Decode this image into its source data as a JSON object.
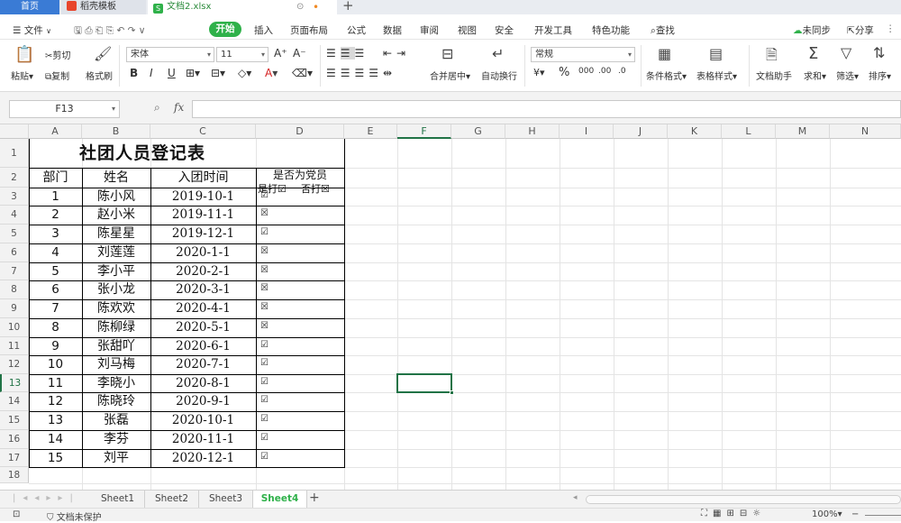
{
  "tabs": {
    "home": "首页",
    "template": "稻壳模板",
    "document": "文档2.xlsx",
    "add": "+"
  },
  "menu": {
    "file": "文件",
    "start": "开始",
    "items": [
      "插入",
      "页面布局",
      "公式",
      "数据",
      "审阅",
      "视图",
      "安全",
      "开发工具",
      "特色功能"
    ],
    "search": "查找",
    "sync": "未同步",
    "share": "分享"
  },
  "ribbon": {
    "paste": "粘贴",
    "cut": "剪切",
    "copy": "复制",
    "format_painter": "格式刷",
    "font_name": "宋体",
    "font_size": "11",
    "bold": "B",
    "italic": "I",
    "underline": "U",
    "merge_center": "合并居中",
    "wrap": "自动换行",
    "number_format": "常规",
    "percent": "%",
    "conditional_format": "条件格式",
    "table_style": "表格样式",
    "doc_assistant": "文档助手",
    "sum": "求和",
    "filter": "筛选",
    "sort": "排序"
  },
  "formula_bar": {
    "name_box": "F13",
    "fx": "fx"
  },
  "sheet": {
    "columns": [
      "A",
      "B",
      "C",
      "D",
      "E",
      "F",
      "G",
      "H",
      "I",
      "J",
      "K",
      "L",
      "M",
      "N"
    ],
    "rows": [
      "1",
      "2",
      "3",
      "4",
      "5",
      "6",
      "7",
      "8",
      "9",
      "10",
      "11",
      "12",
      "13",
      "14",
      "15",
      "16",
      "17",
      "18"
    ],
    "title": "社团人员登记表",
    "headers": {
      "dept": "部门",
      "name": "姓名",
      "join_date": "入团时间",
      "party_title": "是否为党员",
      "party_legend_yes": "是打☑",
      "party_legend_no": "否打☒"
    },
    "data": [
      {
        "dept": "1",
        "name": "陈小风",
        "date": "2019-10-1",
        "party": "☑"
      },
      {
        "dept": "2",
        "name": "赵小米",
        "date": "2019-11-1",
        "party": "☒"
      },
      {
        "dept": "3",
        "name": "陈星星",
        "date": "2019-12-1",
        "party": "☑"
      },
      {
        "dept": "4",
        "name": "刘莲莲",
        "date": "2020-1-1",
        "party": "☒"
      },
      {
        "dept": "5",
        "name": "李小平",
        "date": "2020-2-1",
        "party": "☒"
      },
      {
        "dept": "6",
        "name": "张小龙",
        "date": "2020-3-1",
        "party": "☒"
      },
      {
        "dept": "7",
        "name": "陈欢欢",
        "date": "2020-4-1",
        "party": "☒"
      },
      {
        "dept": "8",
        "name": "陈柳绿",
        "date": "2020-5-1",
        "party": "☒"
      },
      {
        "dept": "9",
        "name": "张甜吖",
        "date": "2020-6-1",
        "party": "☑"
      },
      {
        "dept": "10",
        "name": "刘马梅",
        "date": "2020-7-1",
        "party": "☑"
      },
      {
        "dept": "11",
        "name": "李晓小",
        "date": "2020-8-1",
        "party": "☑"
      },
      {
        "dept": "12",
        "name": "陈晓玲",
        "date": "2020-9-1",
        "party": "☑"
      },
      {
        "dept": "13",
        "name": "张磊",
        "date": "2020-10-1",
        "party": "☑"
      },
      {
        "dept": "14",
        "name": "李芬",
        "date": "2020-11-1",
        "party": "☑"
      },
      {
        "dept": "15",
        "name": "刘平",
        "date": "2020-12-1",
        "party": "☑"
      }
    ],
    "active_cell": "F13"
  },
  "sheet_tabs": [
    "Sheet1",
    "Sheet2",
    "Sheet3",
    "Sheet4"
  ],
  "active_sheet": "Sheet4",
  "status": {
    "protect": "文档未保护",
    "zoom": "100%"
  },
  "colors": {
    "accent_green": "#2fb14a",
    "home_tab_blue": "#3a7bd5",
    "selection_green": "#217346"
  }
}
